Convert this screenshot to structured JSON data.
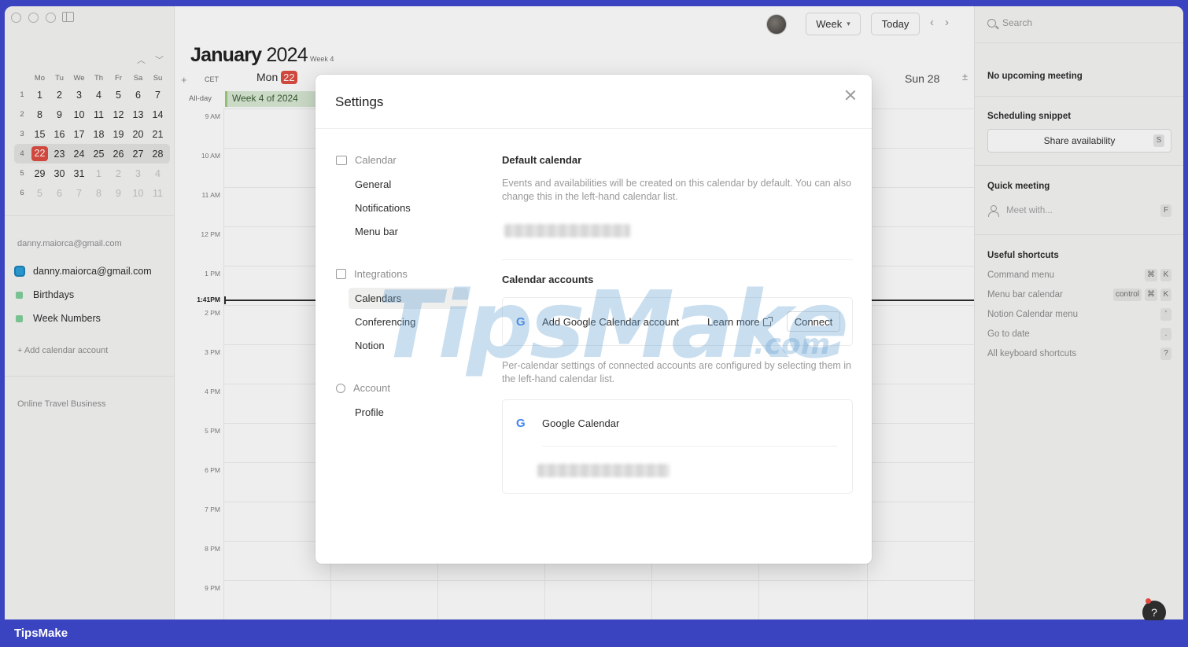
{
  "sidebar": {
    "mini_calendar": {
      "weekday_headers": [
        "Mo",
        "Tu",
        "We",
        "Th",
        "Fr",
        "Sa",
        "Su"
      ],
      "weeks": [
        {
          "num": "1",
          "days": [
            "1",
            "2",
            "3",
            "4",
            "5",
            "6",
            "7"
          ]
        },
        {
          "num": "2",
          "days": [
            "8",
            "9",
            "10",
            "11",
            "12",
            "13",
            "14"
          ]
        },
        {
          "num": "3",
          "days": [
            "15",
            "16",
            "17",
            "18",
            "19",
            "20",
            "21"
          ]
        },
        {
          "num": "4",
          "days": [
            "22",
            "23",
            "24",
            "25",
            "26",
            "27",
            "28"
          ]
        },
        {
          "num": "5",
          "days": [
            "29",
            "30",
            "31",
            "1",
            "2",
            "3",
            "4"
          ]
        },
        {
          "num": "6",
          "days": [
            "5",
            "6",
            "7",
            "8",
            "9",
            "10",
            "11"
          ]
        }
      ]
    },
    "account_email_heading": "danny.maiorca@gmail.com",
    "calendars": [
      {
        "label": "danny.maiorca@gmail.com",
        "color": "#2b9fd9"
      },
      {
        "label": "Birthdays",
        "color": "#7fcf9b"
      },
      {
        "label": "Week Numbers",
        "color": "#7fcf9b"
      }
    ],
    "add_calendar_account": "+ Add calendar account",
    "workspace_label": "Online Travel Business"
  },
  "header": {
    "view_select": "Week",
    "today_button": "Today",
    "month": "January",
    "year": "2024",
    "week_label": "Week 4",
    "timezone": "CET",
    "add": "+",
    "day_mon": "Mon",
    "day_mon_date": "22",
    "day_sun": "Sun 28",
    "expand": "±"
  },
  "grid": {
    "allday_label": "All-day",
    "allday_event": "Week 4 of 2024",
    "time_labels": [
      "9 AM",
      "10 AM",
      "11 AM",
      "12 PM",
      "1 PM",
      "2 PM",
      "3 PM",
      "4 PM",
      "5 PM",
      "6 PM",
      "7 PM",
      "8 PM",
      "9 PM"
    ],
    "now_label": "1:41PM"
  },
  "right_panel": {
    "search_placeholder": "Search",
    "upcoming": "No upcoming meeting",
    "scheduling_heading": "Scheduling snippet",
    "share_availability": "Share availability",
    "share_key": "S",
    "quick_meeting_heading": "Quick meeting",
    "meet_with": "Meet with...",
    "meet_key": "F",
    "shortcuts_heading": "Useful shortcuts",
    "shortcuts": [
      {
        "label": "Command menu",
        "keys": [
          "⌘",
          "K"
        ]
      },
      {
        "label": "Menu bar calendar",
        "keys": [
          "control",
          "⌘",
          "K"
        ]
      },
      {
        "label": "Notion Calendar menu",
        "keys": [
          "'"
        ]
      },
      {
        "label": "Go to date",
        "keys": [
          "."
        ]
      },
      {
        "label": "All keyboard shortcuts",
        "keys": [
          "?"
        ]
      }
    ],
    "help": "?"
  },
  "settings": {
    "title": "Settings",
    "nav": {
      "calendar_group": "Calendar",
      "general": "General",
      "notifications": "Notifications",
      "menu_bar": "Menu bar",
      "integrations_group": "Integrations",
      "calendars": "Calendars",
      "conferencing": "Conferencing",
      "notion": "Notion",
      "account_group": "Account",
      "profile": "Profile"
    },
    "default_calendar_heading": "Default calendar",
    "default_calendar_desc": "Events and availabilities will be created on this calendar by default. You can also change this in the left-hand calendar list.",
    "calendar_accounts_heading": "Calendar accounts",
    "add_google_account": "Add Google Calendar account",
    "learn_more": "Learn more",
    "connect": "Connect",
    "per_calendar_desc": "Per-calendar settings of connected accounts are configured by selecting them in the left-hand calendar list.",
    "google_calendar_label": "Google Calendar"
  },
  "watermark": {
    "brand": "TipsMake",
    "suffix": ".com"
  },
  "footer": {
    "brand": "TipsMake"
  }
}
